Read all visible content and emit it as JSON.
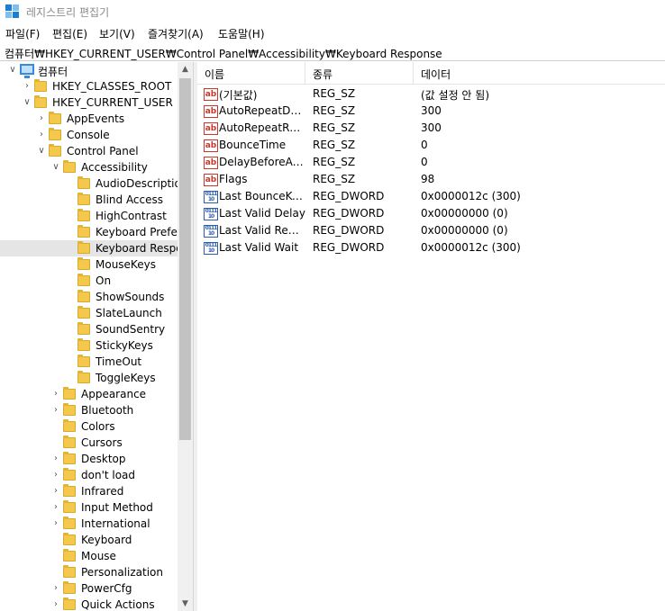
{
  "window": {
    "title": "레지스트리 편집기"
  },
  "menu": [
    "파일(F)",
    "편집(E)",
    "보기(V)",
    "즐겨찾기(A)",
    "도움말(H)"
  ],
  "address": "컴퓨터₩HKEY_CURRENT_USER₩Control Panel₩Accessibility₩Keyboard Response",
  "tree": {
    "root": "컴퓨터",
    "hives": [
      "HKEY_CLASSES_ROOT",
      "HKEY_CURRENT_USER"
    ],
    "hkcu_children": [
      "AppEvents",
      "Console",
      "Control Panel"
    ],
    "control_panel_first": "Accessibility",
    "accessibility_children": [
      "AudioDescription",
      "Blind Access",
      "HighContrast",
      "Keyboard Preference",
      "Keyboard Response",
      "MouseKeys",
      "On",
      "ShowSounds",
      "SlateLaunch",
      "SoundSentry",
      "StickyKeys",
      "TimeOut",
      "ToggleKeys"
    ],
    "control_panel_rest": [
      "Appearance",
      "Bluetooth",
      "Colors",
      "Cursors",
      "Desktop",
      "don't load",
      "Infrared",
      "Input Method",
      "International",
      "Keyboard",
      "Mouse",
      "Personalization",
      "PowerCfg",
      "Quick Actions"
    ],
    "selected": "Keyboard Response"
  },
  "columns": {
    "name": "이름",
    "type": "종류",
    "data": "데이터"
  },
  "values": [
    {
      "name": "(기본값)",
      "type": "REG_SZ",
      "data": "(값 설정 안 됨)",
      "icon": "string-value-icon"
    },
    {
      "name": "AutoRepeatDelay",
      "type": "REG_SZ",
      "data": "300",
      "icon": "string-value-icon"
    },
    {
      "name": "AutoRepeatRate",
      "type": "REG_SZ",
      "data": "300",
      "icon": "string-value-icon"
    },
    {
      "name": "BounceTime",
      "type": "REG_SZ",
      "data": "0",
      "icon": "string-value-icon"
    },
    {
      "name": "DelayBeforeAcceptance",
      "type": "REG_SZ",
      "data": "0",
      "icon": "string-value-icon"
    },
    {
      "name": "Flags",
      "type": "REG_SZ",
      "data": "98",
      "icon": "string-value-icon"
    },
    {
      "name": "Last BounceKeySetting",
      "type": "REG_DWORD",
      "data": "0x0000012c (300)",
      "icon": "dword-value-icon"
    },
    {
      "name": "Last Valid Delay",
      "type": "REG_DWORD",
      "data": "0x00000000 (0)",
      "icon": "dword-value-icon"
    },
    {
      "name": "Last Valid Repeat",
      "type": "REG_DWORD",
      "data": "0x00000000 (0)",
      "icon": "dword-value-icon"
    },
    {
      "name": "Last Valid Wait",
      "type": "REG_DWORD",
      "data": "0x0000012c (300)",
      "icon": "dword-value-icon"
    }
  ],
  "colors": {
    "selected_row": "#e5e5e5",
    "folder": "#f2c94c",
    "string_icon": "#c8372b",
    "dword_icon": "#2a5db0"
  }
}
